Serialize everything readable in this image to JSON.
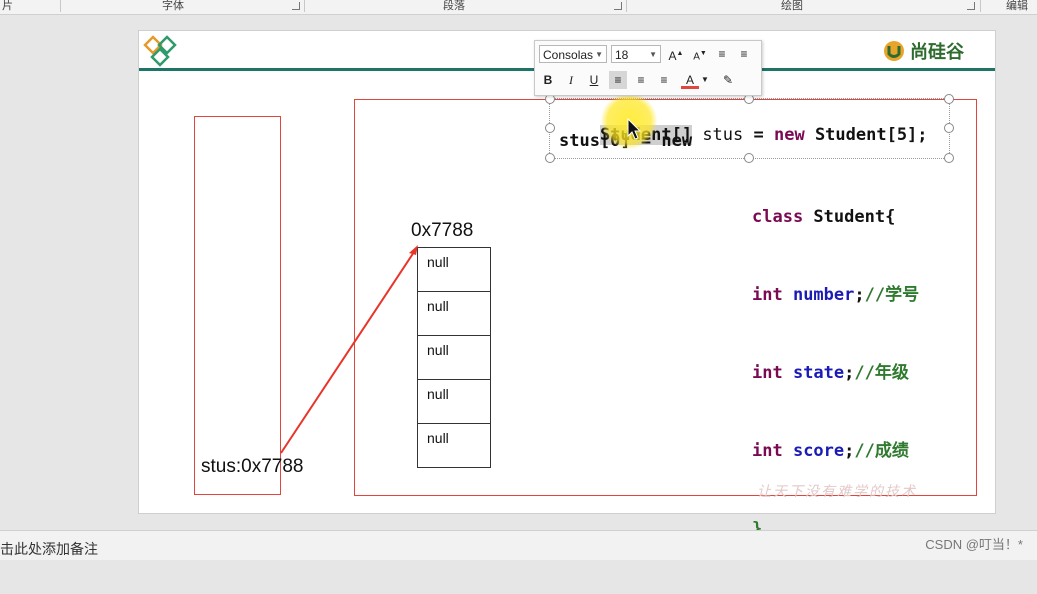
{
  "ribbon": {
    "groups": [
      "片",
      "字体",
      "段落",
      "绘图",
      "编辑"
    ]
  },
  "brand": {
    "right_logo_text": "尚硅谷"
  },
  "diagram": {
    "stack_variable_label": "stus:0x7788",
    "array_address_label": "0x7788",
    "array_cells": [
      "null",
      "null",
      "null",
      "null",
      "null"
    ]
  },
  "code_lines": {
    "line1": {
      "type": "Student[]",
      "var": " stus",
      "assign": " = ",
      "kw": "new",
      "rest": " Student[5];"
    },
    "line2": {
      "text": "stus[0] = new"
    }
  },
  "class_def": {
    "kw_class": "class",
    "name": " Student{",
    "fields": [
      {
        "type": "int",
        "name": " number",
        "sep": ";",
        "comment": "//学号"
      },
      {
        "type": "int",
        "name": " state",
        "sep": ";",
        "comment": "//年级"
      },
      {
        "type": "int",
        "name": " score",
        "sep": ";",
        "comment": "//成绩"
      }
    ],
    "close": "}"
  },
  "mini_toolbar": {
    "font_name": "Consolas",
    "font_size": "18",
    "grow_font": "A",
    "shrink_font": "A",
    "bold": "B",
    "italic": "I",
    "underline": "U",
    "font_color_letter": "A"
  },
  "watermark": "让天下没有难学的技术",
  "status": {
    "notes_placeholder": "击此处添加备注",
    "credit": "CSDN @叮当！*"
  },
  "colors": {
    "accent_line": "#1e7467",
    "box_red": "#e0463e",
    "keyword": "#7a0a52",
    "field": "#1b1bb5",
    "comment": "#2f7a2f"
  }
}
